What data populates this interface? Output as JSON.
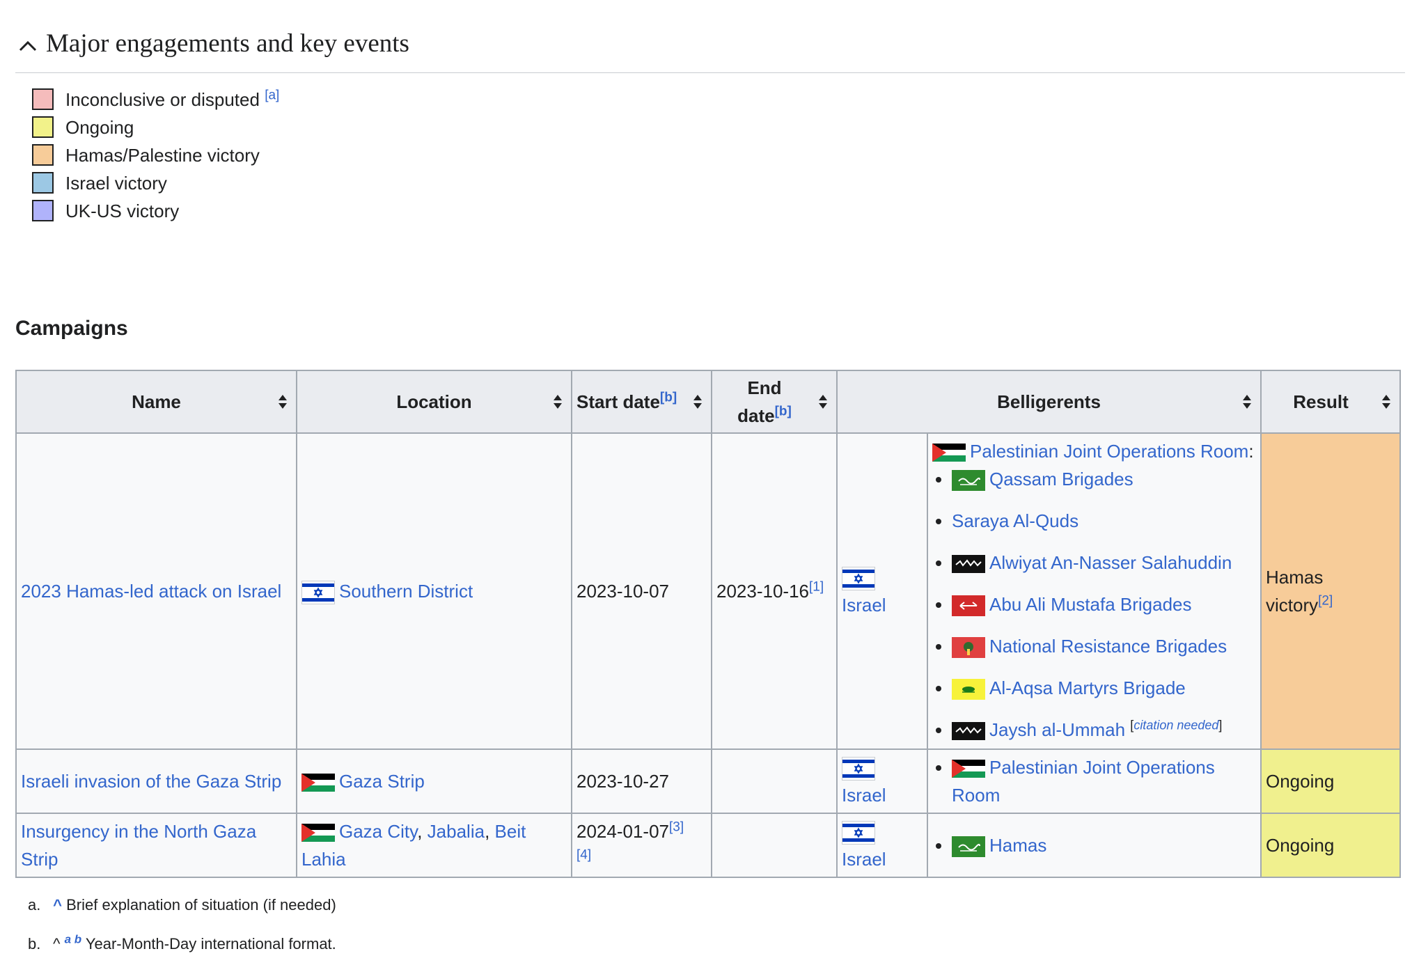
{
  "section": {
    "title": "Major engagements and key events"
  },
  "legend": [
    {
      "label": "Inconclusive or disputed",
      "ref": "[a]",
      "color": "#f5bcbc"
    },
    {
      "label": "Ongoing",
      "ref": "",
      "color": "#f2f28a"
    },
    {
      "label": "Hamas/Palestine victory",
      "ref": "",
      "color": "#f7cc99"
    },
    {
      "label": "Israel victory",
      "ref": "",
      "color": "#9cc8e4"
    },
    {
      "label": "UK-US victory",
      "ref": "",
      "color": "#b0b3fb"
    }
  ],
  "campaigns": {
    "heading": "Campaigns",
    "headers": {
      "name": "Name",
      "location": "Location",
      "start_date": "Start date",
      "start_ref": "[b]",
      "end_date_1": "End",
      "end_date_2": "date",
      "end_ref": "[b]",
      "belligerents": "Belligerents",
      "result": "Result"
    },
    "rows": [
      {
        "name": "2023 Hamas-led attack on Israel",
        "location": "Southern District",
        "start": "2023-10-07",
        "end": "2023-10-16",
        "end_ref": "[1]",
        "side_a": "Israel",
        "side_b_group": "Palestinian Joint Operations Room",
        "side_b_colon": ":",
        "side_b": [
          "Qassam Brigades",
          "Saraya Al-Quds",
          "Alwiyat An-Nasser Salahuddin",
          "Abu Ali Mustafa Brigades",
          "National Resistance Brigades",
          "Al-Aqsa Martyrs Brigade",
          "Jaysh al-Ummah"
        ],
        "citation_needed": "citation needed",
        "result_1": "Hamas",
        "result_2": "victory",
        "result_ref": "[2]"
      },
      {
        "name": "Israeli invasion of the Gaza Strip",
        "location": "Gaza Strip",
        "start": "2023-10-27",
        "side_a": "Israel",
        "side_b_1": "Palestinian Joint Operations",
        "side_b_2": "Room",
        "result": "Ongoing"
      },
      {
        "name_1": "Insurgency in the North Gaza",
        "name_2": "Strip",
        "loc_1": "Gaza City",
        "loc_2": "Jabalia",
        "loc_3a": "Beit",
        "loc_3b": "Lahia",
        "start": "2024-01-07",
        "start_ref_1": "[3]",
        "start_ref_2": "[4]",
        "side_a": "Israel",
        "side_b": "Hamas",
        "result": "Ongoing"
      }
    ]
  },
  "footnotes": [
    {
      "mark": "a.",
      "text": "Brief explanation of situation (if needed)"
    },
    {
      "mark": "b.",
      "backlinks": "a b",
      "text": "Year-Month-Day international format."
    }
  ],
  "icons": {
    "chevron": "chevron-up-icon",
    "sort": "sort-arrows-icon",
    "flags": [
      "israel-flag-icon",
      "palestine-flag-icon",
      "qassam-flag-icon",
      "black-banner-flag-icon",
      "abu-ali-mustafa-flag-icon",
      "national-resistance-flag-icon",
      "al-aqsa-flag-icon"
    ]
  }
}
